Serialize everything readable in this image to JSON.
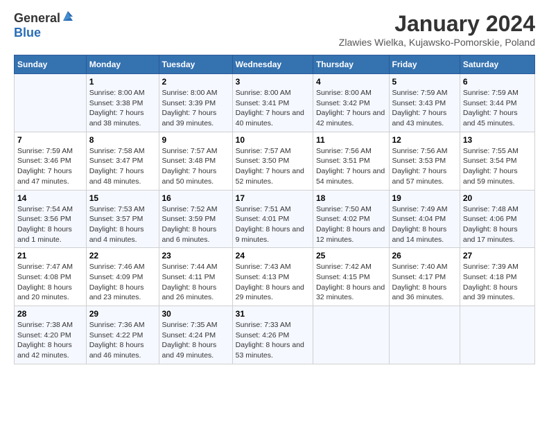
{
  "header": {
    "logo_general": "General",
    "logo_blue": "Blue",
    "month": "January 2024",
    "location": "Zlawies Wielka, Kujawsko-Pomorskie, Poland"
  },
  "weekdays": [
    "Sunday",
    "Monday",
    "Tuesday",
    "Wednesday",
    "Thursday",
    "Friday",
    "Saturday"
  ],
  "weeks": [
    [
      {
        "day": "",
        "sunrise": "",
        "sunset": "",
        "daylight": ""
      },
      {
        "day": "1",
        "sunrise": "Sunrise: 8:00 AM",
        "sunset": "Sunset: 3:38 PM",
        "daylight": "Daylight: 7 hours and 38 minutes."
      },
      {
        "day": "2",
        "sunrise": "Sunrise: 8:00 AM",
        "sunset": "Sunset: 3:39 PM",
        "daylight": "Daylight: 7 hours and 39 minutes."
      },
      {
        "day": "3",
        "sunrise": "Sunrise: 8:00 AM",
        "sunset": "Sunset: 3:41 PM",
        "daylight": "Daylight: 7 hours and 40 minutes."
      },
      {
        "day": "4",
        "sunrise": "Sunrise: 8:00 AM",
        "sunset": "Sunset: 3:42 PM",
        "daylight": "Daylight: 7 hours and 42 minutes."
      },
      {
        "day": "5",
        "sunrise": "Sunrise: 7:59 AM",
        "sunset": "Sunset: 3:43 PM",
        "daylight": "Daylight: 7 hours and 43 minutes."
      },
      {
        "day": "6",
        "sunrise": "Sunrise: 7:59 AM",
        "sunset": "Sunset: 3:44 PM",
        "daylight": "Daylight: 7 hours and 45 minutes."
      }
    ],
    [
      {
        "day": "7",
        "sunrise": "Sunrise: 7:59 AM",
        "sunset": "Sunset: 3:46 PM",
        "daylight": "Daylight: 7 hours and 47 minutes."
      },
      {
        "day": "8",
        "sunrise": "Sunrise: 7:58 AM",
        "sunset": "Sunset: 3:47 PM",
        "daylight": "Daylight: 7 hours and 48 minutes."
      },
      {
        "day": "9",
        "sunrise": "Sunrise: 7:57 AM",
        "sunset": "Sunset: 3:48 PM",
        "daylight": "Daylight: 7 hours and 50 minutes."
      },
      {
        "day": "10",
        "sunrise": "Sunrise: 7:57 AM",
        "sunset": "Sunset: 3:50 PM",
        "daylight": "Daylight: 7 hours and 52 minutes."
      },
      {
        "day": "11",
        "sunrise": "Sunrise: 7:56 AM",
        "sunset": "Sunset: 3:51 PM",
        "daylight": "Daylight: 7 hours and 54 minutes."
      },
      {
        "day": "12",
        "sunrise": "Sunrise: 7:56 AM",
        "sunset": "Sunset: 3:53 PM",
        "daylight": "Daylight: 7 hours and 57 minutes."
      },
      {
        "day": "13",
        "sunrise": "Sunrise: 7:55 AM",
        "sunset": "Sunset: 3:54 PM",
        "daylight": "Daylight: 7 hours and 59 minutes."
      }
    ],
    [
      {
        "day": "14",
        "sunrise": "Sunrise: 7:54 AM",
        "sunset": "Sunset: 3:56 PM",
        "daylight": "Daylight: 8 hours and 1 minute."
      },
      {
        "day": "15",
        "sunrise": "Sunrise: 7:53 AM",
        "sunset": "Sunset: 3:57 PM",
        "daylight": "Daylight: 8 hours and 4 minutes."
      },
      {
        "day": "16",
        "sunrise": "Sunrise: 7:52 AM",
        "sunset": "Sunset: 3:59 PM",
        "daylight": "Daylight: 8 hours and 6 minutes."
      },
      {
        "day": "17",
        "sunrise": "Sunrise: 7:51 AM",
        "sunset": "Sunset: 4:01 PM",
        "daylight": "Daylight: 8 hours and 9 minutes."
      },
      {
        "day": "18",
        "sunrise": "Sunrise: 7:50 AM",
        "sunset": "Sunset: 4:02 PM",
        "daylight": "Daylight: 8 hours and 12 minutes."
      },
      {
        "day": "19",
        "sunrise": "Sunrise: 7:49 AM",
        "sunset": "Sunset: 4:04 PM",
        "daylight": "Daylight: 8 hours and 14 minutes."
      },
      {
        "day": "20",
        "sunrise": "Sunrise: 7:48 AM",
        "sunset": "Sunset: 4:06 PM",
        "daylight": "Daylight: 8 hours and 17 minutes."
      }
    ],
    [
      {
        "day": "21",
        "sunrise": "Sunrise: 7:47 AM",
        "sunset": "Sunset: 4:08 PM",
        "daylight": "Daylight: 8 hours and 20 minutes."
      },
      {
        "day": "22",
        "sunrise": "Sunrise: 7:46 AM",
        "sunset": "Sunset: 4:09 PM",
        "daylight": "Daylight: 8 hours and 23 minutes."
      },
      {
        "day": "23",
        "sunrise": "Sunrise: 7:44 AM",
        "sunset": "Sunset: 4:11 PM",
        "daylight": "Daylight: 8 hours and 26 minutes."
      },
      {
        "day": "24",
        "sunrise": "Sunrise: 7:43 AM",
        "sunset": "Sunset: 4:13 PM",
        "daylight": "Daylight: 8 hours and 29 minutes."
      },
      {
        "day": "25",
        "sunrise": "Sunrise: 7:42 AM",
        "sunset": "Sunset: 4:15 PM",
        "daylight": "Daylight: 8 hours and 32 minutes."
      },
      {
        "day": "26",
        "sunrise": "Sunrise: 7:40 AM",
        "sunset": "Sunset: 4:17 PM",
        "daylight": "Daylight: 8 hours and 36 minutes."
      },
      {
        "day": "27",
        "sunrise": "Sunrise: 7:39 AM",
        "sunset": "Sunset: 4:18 PM",
        "daylight": "Daylight: 8 hours and 39 minutes."
      }
    ],
    [
      {
        "day": "28",
        "sunrise": "Sunrise: 7:38 AM",
        "sunset": "Sunset: 4:20 PM",
        "daylight": "Daylight: 8 hours and 42 minutes."
      },
      {
        "day": "29",
        "sunrise": "Sunrise: 7:36 AM",
        "sunset": "Sunset: 4:22 PM",
        "daylight": "Daylight: 8 hours and 46 minutes."
      },
      {
        "day": "30",
        "sunrise": "Sunrise: 7:35 AM",
        "sunset": "Sunset: 4:24 PM",
        "daylight": "Daylight: 8 hours and 49 minutes."
      },
      {
        "day": "31",
        "sunrise": "Sunrise: 7:33 AM",
        "sunset": "Sunset: 4:26 PM",
        "daylight": "Daylight: 8 hours and 53 minutes."
      },
      {
        "day": "",
        "sunrise": "",
        "sunset": "",
        "daylight": ""
      },
      {
        "day": "",
        "sunrise": "",
        "sunset": "",
        "daylight": ""
      },
      {
        "day": "",
        "sunrise": "",
        "sunset": "",
        "daylight": ""
      }
    ]
  ]
}
